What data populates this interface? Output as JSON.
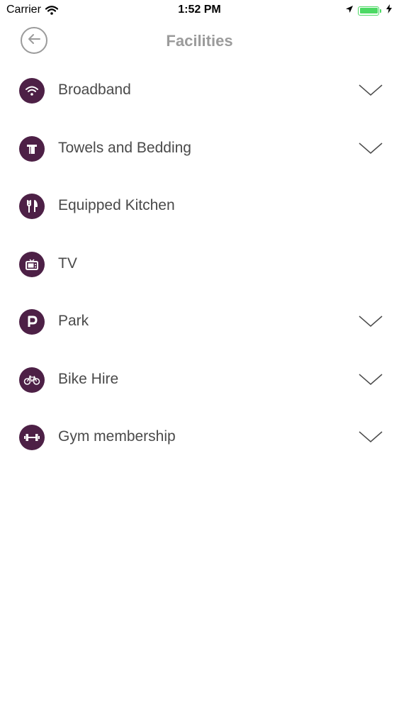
{
  "status_bar": {
    "carrier": "Carrier",
    "time": "1:52 PM",
    "icons": [
      "wifi-icon",
      "location-arrow-icon",
      "battery-icon",
      "charging-bolt-icon"
    ]
  },
  "header": {
    "title": "Facilities",
    "back_icon": "arrow-left-circle-icon"
  },
  "colors": {
    "icon_background": "#4d2046",
    "title": "#9b9b9b",
    "label": "#4a4a4a",
    "battery": "#4cd964"
  },
  "facilities": [
    {
      "label": "Broadband",
      "icon": "wifi-icon",
      "expandable": true
    },
    {
      "label": "Towels and Bedding",
      "icon": "towel-icon",
      "expandable": true
    },
    {
      "label": "Equipped Kitchen",
      "icon": "fork-knife-icon",
      "expandable": false
    },
    {
      "label": "TV",
      "icon": "tv-icon",
      "expandable": false
    },
    {
      "label": "Park",
      "icon": "parking-icon",
      "expandable": true
    },
    {
      "label": "Bike Hire",
      "icon": "bicycle-icon",
      "expandable": true
    },
    {
      "label": "Gym membership",
      "icon": "dumbbell-icon",
      "expandable": true
    }
  ]
}
